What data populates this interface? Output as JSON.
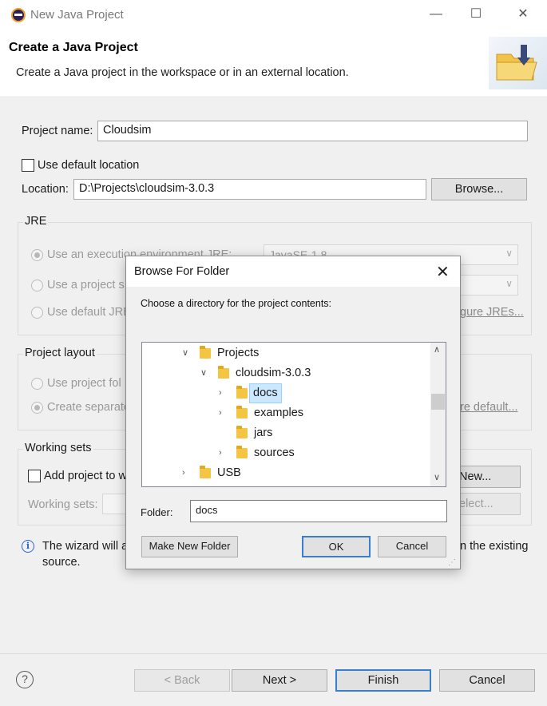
{
  "window": {
    "title": "New Java Project",
    "minimize": "—",
    "maximize": "☐",
    "close": "✕"
  },
  "header": {
    "title": "Create a Java Project",
    "description": "Create a Java project in the workspace or in an external location."
  },
  "form": {
    "project_name_label": "Project name:",
    "project_name_value": "Cloudsim",
    "use_default_location_label": "Use default location",
    "use_default_location_checked": false,
    "location_label": "Location:",
    "location_value": "D:\\Projects\\cloudsim-3.0.3",
    "browse_label": "Browse..."
  },
  "jre": {
    "group_title": "JRE",
    "opt_exec_env": "Use an execution environment JRE:",
    "exec_env_value": "JavaSE-1.8",
    "opt_project_specific": "Use a project s",
    "opt_default_jre": "Use default JRE",
    "configure_link": "gure JREs..."
  },
  "layout": {
    "group_title": "Project layout",
    "opt_project_folder": "Use project fol",
    "opt_separate": "Create separate",
    "configure_default_link": "re default..."
  },
  "working_sets": {
    "group_title": "Working sets",
    "add_label": "Add project to w",
    "new_button": "New...",
    "sets_label": "Working sets:",
    "select_button": "elect..."
  },
  "info": {
    "text_left": "The wizard will a",
    "text_right": "n the existing",
    "text_line2": "source."
  },
  "footer": {
    "help": "?",
    "back": "< Back",
    "next": "Next >",
    "finish": "Finish",
    "cancel": "Cancel"
  },
  "dialog": {
    "title": "Browse For Folder",
    "close": "✕",
    "instruction": "Choose a directory for the project contents:",
    "tree": [
      {
        "label": "Projects",
        "expanded": true
      },
      {
        "label": "cloudsim-3.0.3",
        "expanded": true
      },
      {
        "label": "docs",
        "selected": true
      },
      {
        "label": "examples"
      },
      {
        "label": "jars"
      },
      {
        "label": "sources"
      },
      {
        "label": "USB"
      }
    ],
    "folder_label": "Folder:",
    "folder_value": "docs",
    "make_new_folder": "Make New Folder",
    "ok": "OK",
    "cancel": "Cancel"
  }
}
